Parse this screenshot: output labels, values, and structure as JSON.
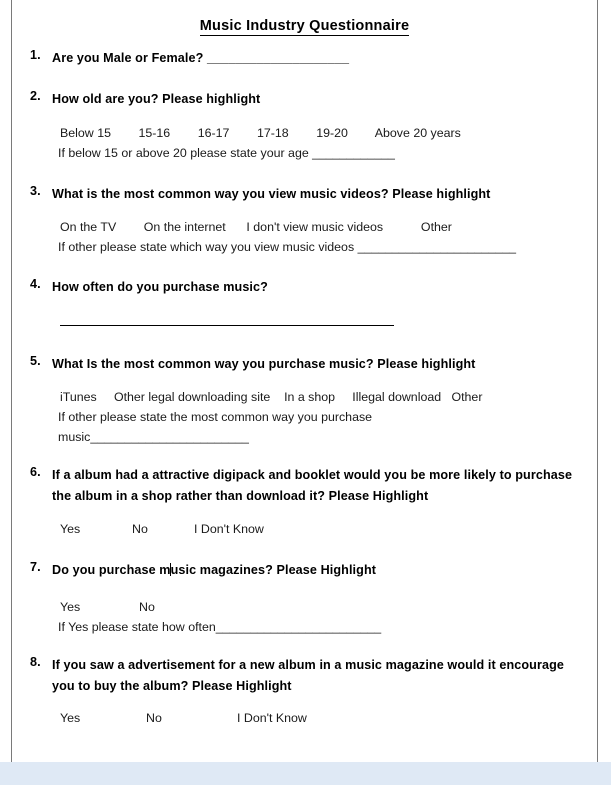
{
  "document": {
    "title": "Music Industry Questionnaire",
    "questions": [
      {
        "number": "1.",
        "text": "Are you Male or Female?  ____________________"
      },
      {
        "number": "2.",
        "text": "How old are you? Please highlight",
        "options": "Below 15        15-16        16-17        17-18        19-20        Above 20 years",
        "note": "If below 15 or above 20 please state your age ____________"
      },
      {
        "number": "3.",
        "text": "What is the most common  way you view music videos? Please highlight",
        "options": "On the TV        On the internet      I don't view music videos           Other",
        "note": "If other please state which way you view music videos _______________________"
      },
      {
        "number": "4.",
        "text": "How often do you purchase music?",
        "answer_line": true
      },
      {
        "number": "5.",
        "text": "What Is the most common way you purchase music? Please highlight",
        "options": "iTunes     Other legal downloading site    In a shop     Illegal download   Other",
        "note": "If other please state the most common way you purchase",
        "note2": "music_______________________"
      },
      {
        "number": "6.",
        "text": "If a album had a attractive digipack and booklet would you be more likely to purchase the album in a shop rather than download it?  Please Highlight",
        "answers": [
          "Yes",
          "No",
          "I Don't Know"
        ]
      },
      {
        "number": "7.",
        "text_before_caret": " Do you purchase m",
        "text_after_caret": "usic magazines? Please Highlight",
        "answers": [
          "Yes",
          "No"
        ],
        "note": "If Yes please state how often________________________"
      },
      {
        "number": "8.",
        "text": "If you saw a advertisement for a new album in a music magazine would it encourage you to buy the album? Please Highlight",
        "answers": [
          "Yes",
          "No",
          "I Don't Know"
        ]
      }
    ]
  },
  "colors": {
    "page_background": "#ffffff",
    "text": "#000000",
    "page_border": "#7a7a7a",
    "page_gap": "#dfe9f5",
    "page_bottom_rule": "#4a72a8"
  }
}
